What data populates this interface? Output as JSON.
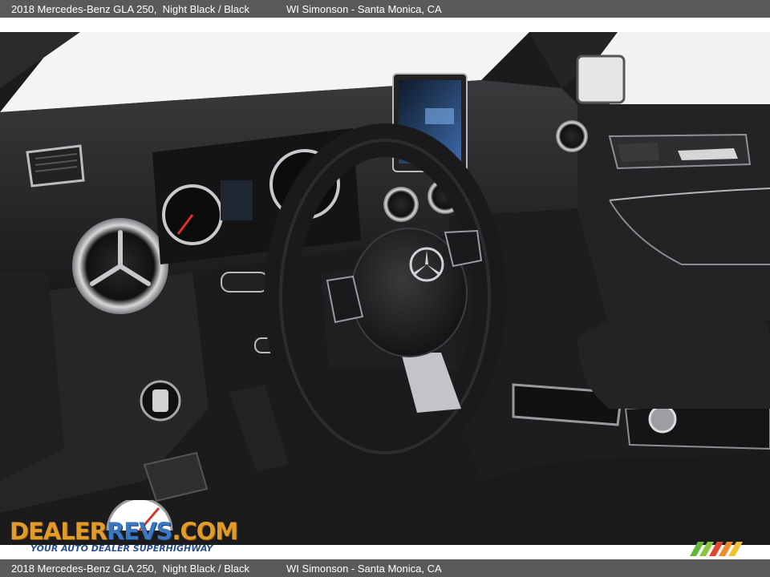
{
  "caption": {
    "vehicle": "2018 Mercedes-Benz GLA 250,  Night Black / Black",
    "dealer": "WI Simonson - Santa Monica, CA"
  },
  "watermark": {
    "logo_part1": "DEALER",
    "logo_part2": "REVS",
    "logo_part3": ".COM",
    "tagline": "YOUR AUTO DEALER SUPERHIGHWAY",
    "colors": {
      "orange": "#e09b2a",
      "blue": "#3b78c2"
    }
  },
  "photo": {
    "subject": "steering-wheel-and-dashboard",
    "icons": [
      "mercedes-star-icon"
    ]
  }
}
